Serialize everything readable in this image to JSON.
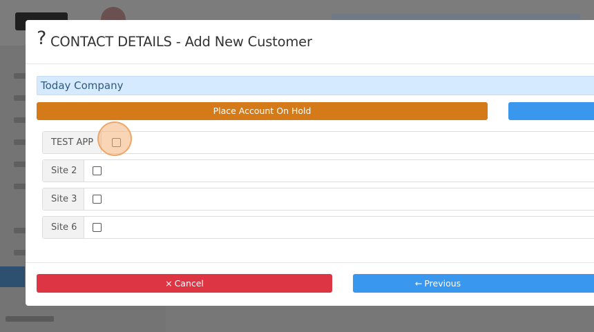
{
  "modal": {
    "help_glyph": "?",
    "title": "CONTACT DETAILS - Add New Customer"
  },
  "company": {
    "name": "Today Company"
  },
  "actions": {
    "hold_label": "Place Account On Hold"
  },
  "sites": [
    {
      "label": "TEST APP",
      "checked": false
    },
    {
      "label": "Site 2",
      "checked": false
    },
    {
      "label": "Site 3",
      "checked": false
    },
    {
      "label": "Site 6",
      "checked": false
    }
  ],
  "footer": {
    "cancel_icon": "×",
    "cancel_label": "Cancel",
    "previous_icon": "←",
    "previous_label": "Previous"
  },
  "colors": {
    "hold": "#d47a18",
    "primary": "#3a97ee",
    "danger": "#de3545",
    "company_bar": "#d5eaff"
  }
}
